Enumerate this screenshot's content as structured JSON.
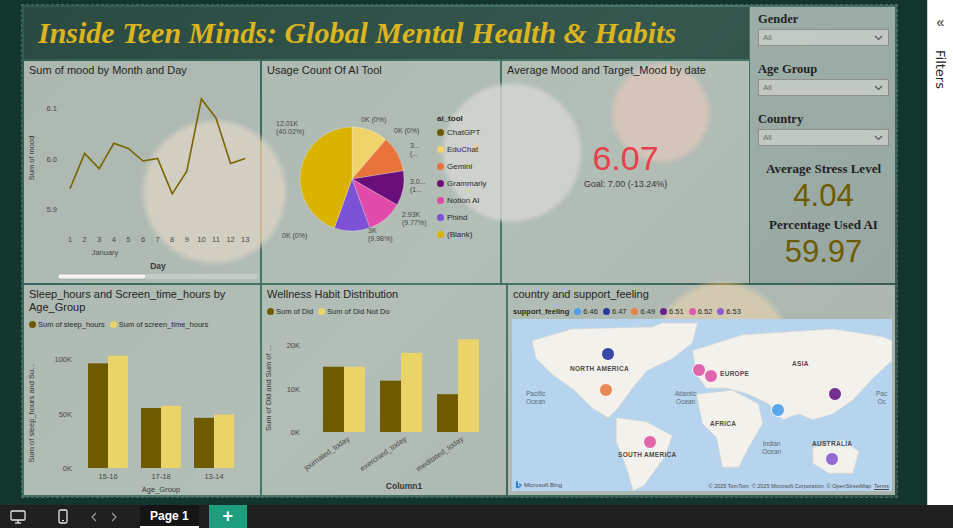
{
  "report": {
    "title": "Inside Teen Minds: Global Mental Health & Habits"
  },
  "slicers": [
    {
      "label": "Gender",
      "value": "All"
    },
    {
      "label": "Age Group",
      "value": "All"
    },
    {
      "label": "Country",
      "value": "All"
    }
  ],
  "cards": [
    {
      "label": "Average Stress Level",
      "value": "4.04"
    },
    {
      "label": "Percentage Used AI",
      "value": "59.97"
    }
  ],
  "mood_line_chart": {
    "title": "Sum of mood by Month and Day",
    "y_axis_title": "Sum of mood",
    "x_axis_title": "Day",
    "month": "January",
    "y_ticks": [
      {
        "label": "6.1",
        "value": 6.1
      },
      {
        "label": "6.0",
        "value": 6.0
      },
      {
        "label": "5.9",
        "value": 5.9
      }
    ],
    "x_ticks": [
      "1",
      "2",
      "3",
      "4",
      "5",
      "6",
      "7",
      "8",
      "9",
      "10",
      "11",
      "12",
      "13"
    ],
    "values": [
      5.94,
      6.01,
      5.98,
      6.03,
      6.02,
      5.995,
      6.0,
      5.93,
      5.975,
      6.118,
      6.08,
      5.99,
      6.0
    ],
    "color": "#7a6400",
    "scrollbar": {
      "level": 0.44
    }
  },
  "ai_tool_pie": {
    "title": "Usage Count Of AI Tool",
    "legend_title": "ai_tool",
    "slices": [
      {
        "name": "ChatGPT",
        "value": 0,
        "color": "#6b5a00"
      },
      {
        "name": "EduChat",
        "value": 3.05,
        "color": "#efd46b"
      },
      {
        "name": "Gemini",
        "value": 3.02,
        "color": "#e8743b"
      },
      {
        "name": "Grammarly",
        "value": 2.93,
        "color": "#6a0f7a"
      },
      {
        "name": "Notion AI",
        "value": 3.0,
        "color": "#e04aa8"
      },
      {
        "name": "Phind",
        "value": 3.0,
        "color": "#7b52d6"
      },
      {
        "name": "(Blank)",
        "value": 12.01,
        "color": "#d9b300"
      }
    ],
    "labels": [
      {
        "lines": [
          "12.01K",
          "(40.02%)"
        ]
      },
      {
        "lines": [
          "0K (0%)"
        ]
      },
      {
        "lines": [
          "0K (0%)"
        ]
      },
      {
        "lines": [
          "3...",
          "(..."
        ]
      },
      {
        "lines": [
          "3.0...",
          "(1..."
        ]
      },
      {
        "lines": [
          "2.93K",
          "(9.77%)"
        ]
      },
      {
        "lines": [
          "3K",
          "(9.98%)"
        ]
      },
      {
        "lines": [
          "0K (0%)"
        ]
      }
    ]
  },
  "mood_kpi": {
    "title": "Average Mood and Target_Mood by date",
    "value": "6.07",
    "goal": "Goal: 7.00 (-13.24%)"
  },
  "sleep_screen_chart": {
    "title": "Sleep_hours and Screen_time_hours by Age_Group",
    "y_axis_title": "Sum of sleep_hours and Su...",
    "x_axis_title": "Age_Group",
    "y_ticks": [
      {
        "label": "100K",
        "value": 100000
      },
      {
        "label": "50K",
        "value": 50000
      },
      {
        "label": "0K",
        "value": 0
      }
    ],
    "categories": [
      "15-16",
      "17-18",
      "13-14"
    ],
    "series": [
      {
        "name": "Sum of sleep_hours",
        "color": "#6e5b00",
        "values": [
          96000,
          55000,
          46000
        ]
      },
      {
        "name": "Sum of screen_time_hours",
        "color": "#ead46a",
        "values": [
          103000,
          57000,
          49000
        ]
      }
    ]
  },
  "wellness_chart": {
    "title": "Wellness Habit Distribution",
    "y_axis_title": "Sum of Did and Sum of ...",
    "x_axis_title": "Column1",
    "y_ticks": [
      {
        "label": "20K",
        "value": 20000
      },
      {
        "label": "10K",
        "value": 10000
      },
      {
        "label": "0K",
        "value": 0
      }
    ],
    "categories": [
      "journaled_today",
      "exercised_today",
      "meditated_today"
    ],
    "series": [
      {
        "name": "Sum of Did",
        "color": "#6e5b00",
        "values": [
          15000,
          11800,
          8700
        ]
      },
      {
        "name": "Sum of Did Not Do",
        "color": "#ead46a",
        "values": [
          15000,
          18200,
          21300
        ]
      }
    ]
  },
  "support_map": {
    "title": "country and support_feeling",
    "legend_title": "support_feeling",
    "legend": [
      {
        "label": "6.46",
        "color": "#4da3ea"
      },
      {
        "label": "6.47",
        "color": "#2b3a9e"
      },
      {
        "label": "6.49",
        "color": "#e8804a"
      },
      {
        "label": "6.51",
        "color": "#6b1f8a"
      },
      {
        "label": "6.52",
        "color": "#e05aa8"
      },
      {
        "label": "6.53",
        "color": "#8a5fd0"
      }
    ],
    "regions": [
      "NORTH AMERICA",
      "EUROPE",
      "ASIA",
      "AFRICA",
      "SOUTH AMERICA",
      "AUSTRALIA"
    ],
    "oceans": [
      {
        "lines": [
          "Pacific",
          "Ocean"
        ]
      },
      {
        "lines": [
          "Atlantic",
          "Ocean"
        ]
      },
      {
        "lines": [
          "Indian",
          "Ocean"
        ]
      },
      {
        "lines": [
          "Pac",
          "Oc"
        ]
      }
    ],
    "bubbles": [
      {
        "color": "#2b3a9e"
      },
      {
        "color": "#e8804a"
      },
      {
        "color": "#e05aa8"
      },
      {
        "color": "#e05aa8"
      },
      {
        "color": "#6b1f8a"
      },
      {
        "color": "#4da3ea"
      },
      {
        "color": "#e05aa8"
      },
      {
        "color": "#8a5fd0"
      }
    ],
    "brand": "Microsoft Bing",
    "attribution": "© 2025 TomTom, © 2025 Microsoft Corporation, © OpenStreetMap",
    "terms": "Terms"
  },
  "filters_pane": {
    "collapse": "«",
    "label": "Filters"
  },
  "page_bar": {
    "pages": [
      {
        "label": "Page 1",
        "selected": true
      }
    ],
    "add": "+"
  }
}
